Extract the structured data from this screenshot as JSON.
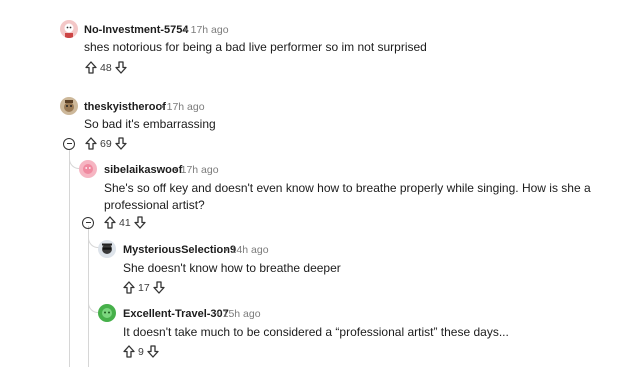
{
  "comments": [
    {
      "author": "No-Investment-5754",
      "time": "17h ago",
      "body": "shes notorious for being a bad live performer so im not surprised",
      "score": "48"
    },
    {
      "author": "theskyistheroof",
      "time": "17h ago",
      "body": "So bad it's embarrassing",
      "score": "69"
    },
    {
      "author": "sibelaikaswoof",
      "time": "17h ago",
      "body": "She's so off key and doesn't even know how to breathe properly while singing. How is she a professional artist?",
      "score": "41"
    },
    {
      "author": "MysteriousSelection9",
      "time": "14h ago",
      "body": "She doesn't know how to breathe deeper",
      "score": "17"
    },
    {
      "author": "Excellent-Travel-307",
      "time": "15h ago",
      "body": "It doesn't take much to be considered a “professional artist” these days...",
      "score": "9"
    }
  ],
  "separator": "•",
  "icons": {
    "upvote": "upvote-arrow-icon",
    "downvote": "downvote-arrow-icon",
    "collapse": "collapse-minus-icon"
  },
  "colors": {
    "avatar1": "#f3c7c7",
    "avatar2": "#9a7a55",
    "avatar3": "#f08aa0",
    "avatar4": "#dde3ea",
    "avatar5": "#46b04a"
  }
}
